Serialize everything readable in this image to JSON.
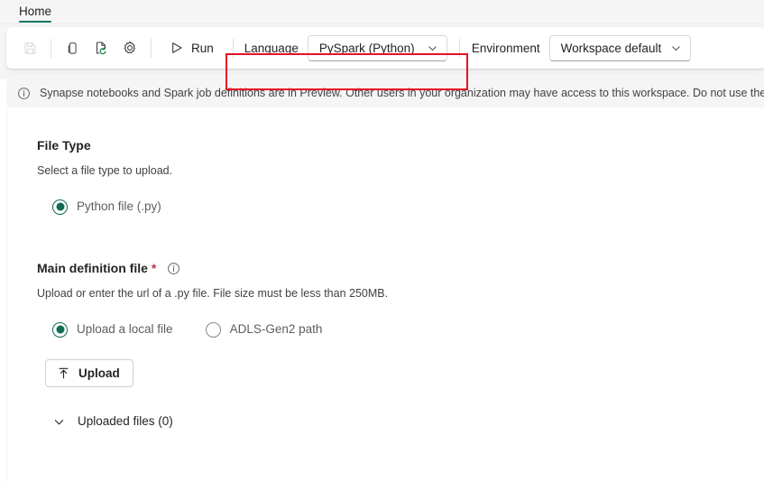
{
  "ribbon": {
    "tabs": [
      {
        "label": "Home",
        "active": true
      }
    ]
  },
  "toolbar": {
    "save": {
      "name": "save-icon",
      "label": "Save",
      "disabled": true
    },
    "copy": {
      "name": "copy-icon",
      "label": "Copy"
    },
    "refresh_doc": {
      "name": "refresh-document-icon",
      "label": "Refresh"
    },
    "settings": {
      "name": "gear-icon",
      "label": "Settings"
    },
    "run_label": "Run",
    "language_label": "Language",
    "language_value": "PySpark (Python)",
    "environment_label": "Environment",
    "environment_value": "Workspace default"
  },
  "annotation": {
    "highlight_color": "#e81123",
    "target": "language-control"
  },
  "info_bar": {
    "text": "Synapse notebooks and Spark job definitions are in Preview. Other users in your organization may have access to this workspace. Do not use these items"
  },
  "file_type": {
    "title": "File Type",
    "description": "Select a file type to upload.",
    "options": [
      {
        "label": "Python file (.py)",
        "checked": true
      }
    ]
  },
  "main_definition": {
    "title": "Main definition file",
    "required_marker": "*",
    "description": "Upload or enter the url of a .py file. File size must be less than 250MB.",
    "options": [
      {
        "label": "Upload a local file",
        "checked": true
      },
      {
        "label": "ADLS-Gen2 path",
        "checked": false
      }
    ],
    "upload_button": "Upload",
    "uploaded_files_label": "Uploaded files (0)"
  },
  "colors": {
    "accent_green": "#117865",
    "radio_green": "#0f6b53",
    "required_red": "#c4314b",
    "annotation_red": "#e81123"
  }
}
